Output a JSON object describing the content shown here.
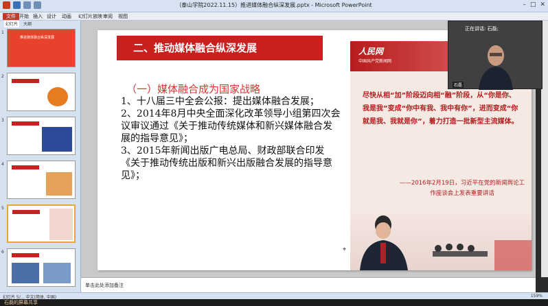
{
  "window": {
    "title": "（泰山学院2022.11.15）推进媒体融合纵深发展.pptx - Microsoft PowerPoint"
  },
  "ribbon": {
    "tabs": [
      "文件",
      "开始",
      "插入",
      "设计",
      "动画",
      "幻灯片放映",
      "审阅",
      "视图"
    ],
    "active_tab": "文件"
  },
  "left_panel": {
    "tabs": [
      "幻灯片",
      "大纲"
    ],
    "thumbnails": [
      {
        "num": "1",
        "title": "推进媒体融合纵深发展",
        "selected": false
      },
      {
        "num": "2",
        "title": "",
        "selected": false
      },
      {
        "num": "3",
        "title": "",
        "selected": false
      },
      {
        "num": "4",
        "title": "",
        "selected": false
      },
      {
        "num": "5",
        "title": "",
        "selected": true
      },
      {
        "num": "6",
        "title": "",
        "selected": false
      }
    ]
  },
  "slide": {
    "title": "二、推动媒体融合纵深发展",
    "subtitle": "（一）媒体融合成为国家战略",
    "points": [
      "1、十八届三中全会公报：提出媒体融合发展；",
      "2、2014年8月中央全面深化改革领导小组第四次会议审议通过《关于推动传统媒体和新兴媒体融合发展的指导意见》；",
      "3、2015年新闻出版广电总局、财政部联合印发《关于推动传统出版和新兴出版融合发展的指导意见》；"
    ],
    "quote_panel": {
      "logo": "人民网",
      "logo_sub": "中国共产党新闻网",
      "quote": "尽快从相“加”阶段迈向相“融”阶段，从“你是你、我是我”变成“你中有我、我中有你”，进而变成“你就是我、我就是你”，着力打造一批新型主流媒体。",
      "attribution": "——2016年2月19日，习近平在党的新闻舆论工作座谈会上发表重要讲话"
    }
  },
  "notes": {
    "placeholder": "单击此处添加备注"
  },
  "status_bar": {
    "left": "幻灯片 5/…  中文(简体, 中国)",
    "zoom": "159%"
  },
  "video": {
    "speaking_label": "正在讲话: 石磊;",
    "name": "石磊"
  },
  "share_bar": {
    "text": "石磊的屏幕共享"
  }
}
